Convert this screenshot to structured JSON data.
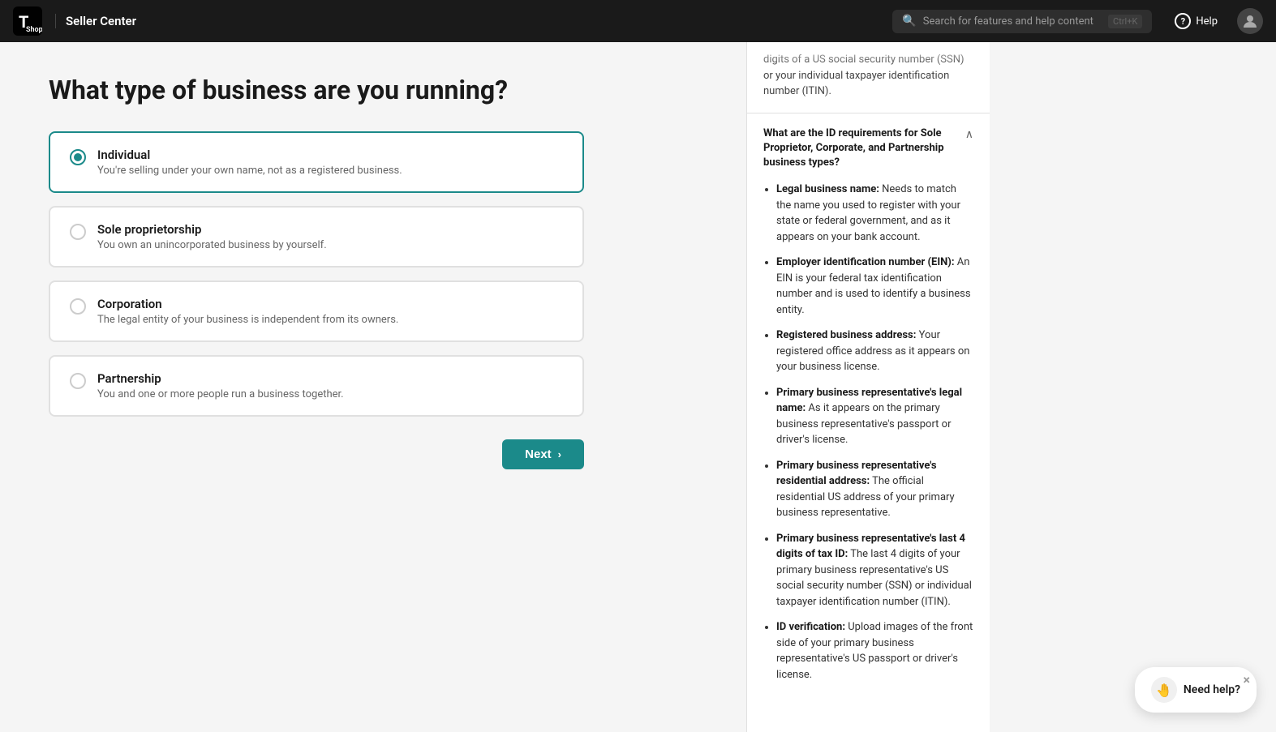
{
  "navbar": {
    "brand": "Seller Center",
    "search_placeholder": "Search for features and help content",
    "search_shortcut": "Ctrl+K",
    "help_label": "Help"
  },
  "page": {
    "title": "What type of business are you running?"
  },
  "business_options": [
    {
      "id": "individual",
      "name": "Individual",
      "desc": "You're selling under your own name, not as a registered business.",
      "selected": true
    },
    {
      "id": "sole_proprietorship",
      "name": "Sole proprietorship",
      "desc": "You own an unincorporated business by yourself.",
      "selected": false
    },
    {
      "id": "corporation",
      "name": "Corporation",
      "desc": "The legal entity of your business is independent from its owners.",
      "selected": false
    },
    {
      "id": "partnership",
      "name": "Partnership",
      "desc": "You and one or more people run a business together.",
      "selected": false
    }
  ],
  "next_button": "Next",
  "right_panel": {
    "fade_text": "digits of a US social security number (SSN) or your individual taxpayer identification number (ITIN).",
    "section_title": "What are the ID requirements for Sole Proprietor, Corporate, and Partnership business types?",
    "list_items": [
      {
        "bold": "Legal business name:",
        "text": " Needs to match the name you used to register with your state or federal government, and as it appears on your bank account."
      },
      {
        "bold": "Employer identification number (EIN):",
        "text": " An EIN is your federal tax identification number and is used to identify a business entity."
      },
      {
        "bold": "Registered business address:",
        "text": " Your registered office address as it appears on your business license."
      },
      {
        "bold": "Primary business representative's legal name:",
        "text": " As it appears on the primary business representative's passport or driver's license."
      },
      {
        "bold": "Primary business representative's residential address:",
        "text": " The official residential US address of your primary business representative."
      },
      {
        "bold": "Primary business representative's last 4 digits of tax ID:",
        "text": " The last 4 digits of your primary business representative's US social security number (SSN) or individual taxpayer identification number (ITIN)."
      },
      {
        "bold": "ID verification:",
        "text": " Upload images of the front side of your primary business representative's US passport or driver's license."
      }
    ]
  },
  "need_help": {
    "label": "Need help?"
  }
}
